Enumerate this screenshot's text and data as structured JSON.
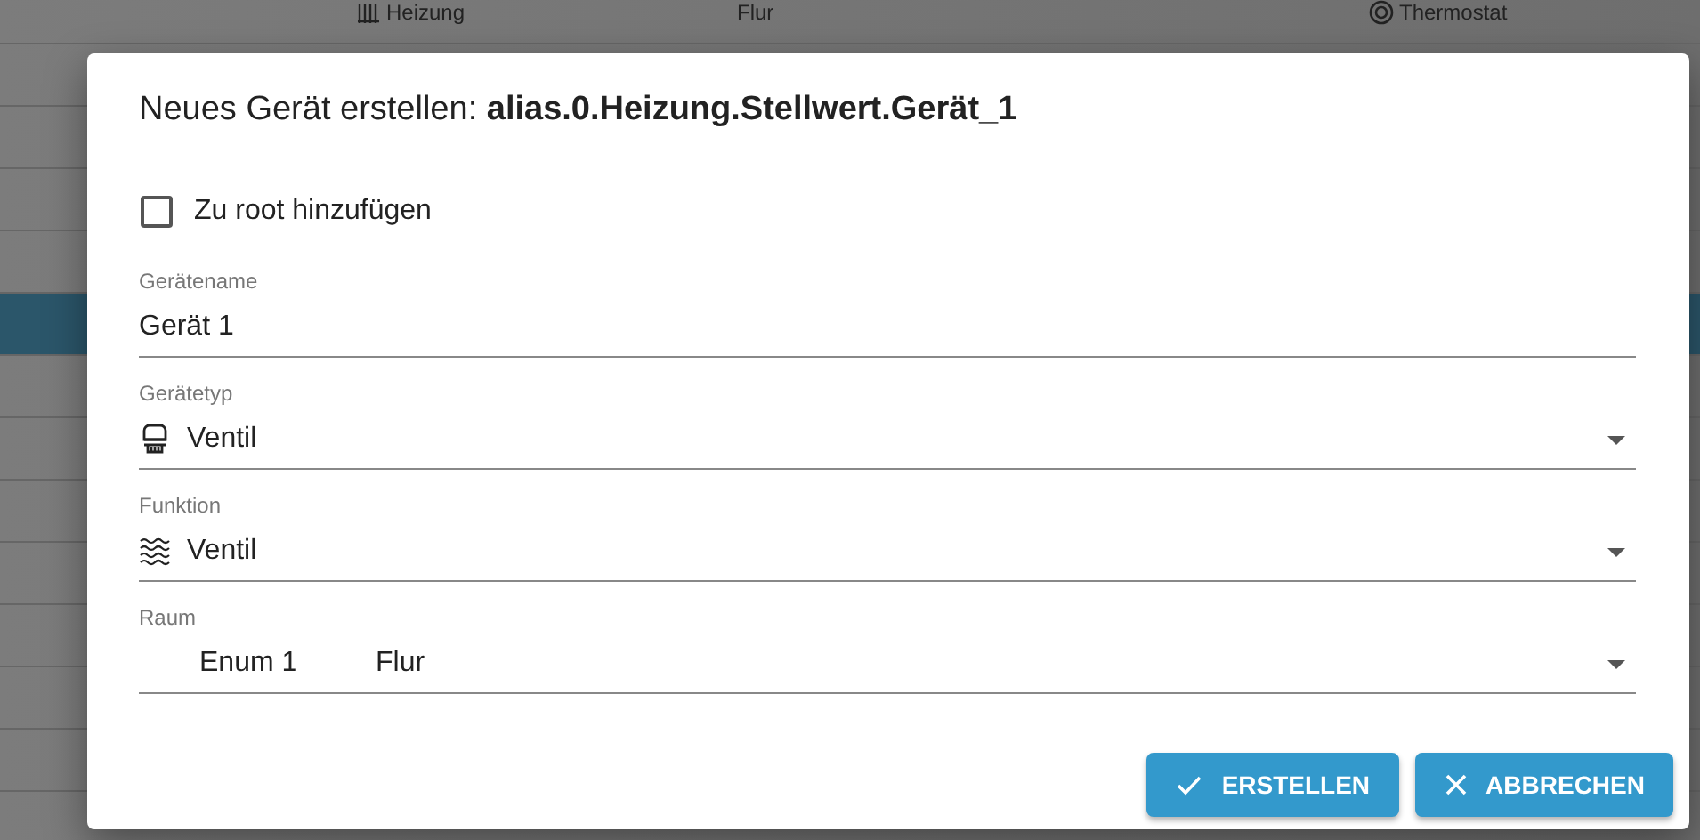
{
  "background_table": {
    "top_row": {
      "column_1": "Heizung",
      "column_2": "Flur",
      "column_3": "Thermostat"
    },
    "rows": [
      {
        "selected": false
      },
      {
        "selected": false
      },
      {
        "selected": false
      },
      {
        "selected": false
      },
      {
        "selected": true
      },
      {
        "selected": false
      },
      {
        "selected": false
      },
      {
        "selected": false
      },
      {
        "selected": false
      },
      {
        "selected": false
      },
      {
        "selected": false
      },
      {
        "selected": false
      }
    ]
  },
  "dialog": {
    "title": "Neues Gerät erstellen: **alias.0.Heizung.Stellwert.Gerät_1**",
    "checkbox": {
      "label": "Zu root hinzufügen",
      "checked": false
    },
    "fields": [
      {
        "kind": "text",
        "label": "Gerätename",
        "value": "Gerät 1"
      },
      {
        "kind": "select",
        "label": "Gerätetyp",
        "value": "Ventil"
      },
      {
        "kind": "select",
        "label": "Funktion",
        "value": "Ventil"
      },
      {
        "kind": "select",
        "label": "Raum",
        "prefix": "Enum 1",
        "value": "Flur"
      }
    ],
    "buttons": [
      {
        "kind": "confirm",
        "label": "ERSTELLEN"
      },
      {
        "kind": "cancel",
        "label": "ABBRECHEN"
      }
    ]
  }
}
